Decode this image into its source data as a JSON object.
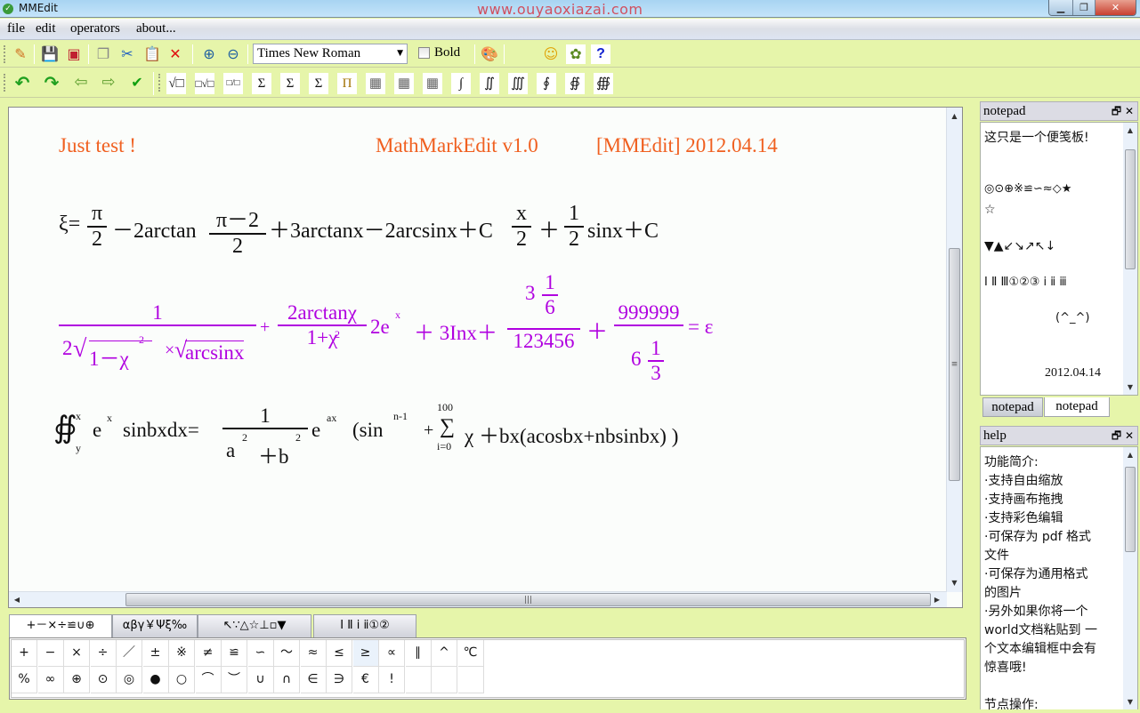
{
  "window": {
    "title": "MMEdit",
    "watermark": "www.ouyaoxiazai.com",
    "minimize": "▁",
    "restore": "❐",
    "close": "✕"
  },
  "menu": [
    "file",
    "edit",
    "operators",
    "about..."
  ],
  "toolbar1": {
    "icons": [
      "edit-pencil-icon",
      "save-icon",
      "save-pdf-icon",
      "copy-icon",
      "cut-icon",
      "paste-icon",
      "delete-icon",
      "zoom-in-icon",
      "zoom-out-icon"
    ],
    "font_family": "Times New Roman",
    "bold_label": "Bold",
    "bold_checked": false,
    "extra_icons": [
      "palette-icon",
      "smiley-icon",
      "plant-icon",
      "help-icon"
    ]
  },
  "toolbar2": {
    "nav_icons": [
      "undo-icon",
      "redo-icon",
      "back-icon",
      "forward-icon",
      "confirm-icon"
    ],
    "math_buttons": [
      "√□",
      "□√□",
      "□/□",
      "Σ",
      "Σ",
      "Σ",
      "Π",
      "▦",
      "▦",
      "▦",
      "∫",
      "∬",
      "∭",
      "∮",
      "∯",
      "∰"
    ]
  },
  "canvas": {
    "header_left": "Just  test !",
    "header_center": "MathMarkEdit v1.0",
    "header_right": "[MMEdit]  2012.04.14",
    "colors": {
      "header": "#f06020",
      "eq1": "#111111",
      "eq2": "#b000e0",
      "eq3": "#111111"
    },
    "eq1": {
      "lhs": "ξ=",
      "f1_num": "π",
      "f1_den": "2",
      "t1": "－2arctan",
      "f2_num": "π－2",
      "f2_den": "2",
      "t2": "＋3arctanx－2arcsinx＋C",
      "f3_num": "x",
      "f3_den": "2",
      "t3": "＋",
      "f4_num": "1",
      "f4_den": "2",
      "t4": "sinx＋C"
    },
    "eq2": {
      "f1_num": "1",
      "f1_den_a": "2",
      "f1_den_root1": "1－χ",
      "f1_den_exp": "2",
      "f1_den_times": "×",
      "f1_den_root2": "arcsinx",
      "plus1": "+",
      "f2_num": "2arctanχ",
      "f2_den": "1+χ",
      "f2_den_exp": "2",
      "t1": "2e",
      "t1_exp": "x",
      "t2": "＋ 3Inx＋",
      "f3_num_whole": "3",
      "f3_num_num": "1",
      "f3_num_den": "6",
      "f3_den": "123456",
      "plus2": "＋",
      "f4_num": "999999",
      "f4_den_whole": "6",
      "f4_den_num": "1",
      "f4_den_den": "3",
      "rhs": "= ε"
    },
    "eq3": {
      "integral": "∯",
      "int_upper": "x",
      "int_lower": "y",
      "t1": "e",
      "t1_exp": "x",
      "t2": "sinbxdx=",
      "f_num": "1",
      "f_den_a": "a",
      "f_den_a_exp": "2",
      "f_den_b": "＋b",
      "f_den_b_exp": "2",
      "t3": "e",
      "t3_exp": "ax",
      "t4": "(sin",
      "t4_exp": "n-1",
      "t5": "+",
      "sum": "∑",
      "sum_upper": "100",
      "sum_lower": "i=0",
      "t6": "χ ＋bx(acosbx+nbsinbx) )"
    }
  },
  "notepad": {
    "title": "notepad",
    "lines": [
      "这只是一个便笺板!",
      "",
      "◎⊙⊕※≌∽≈◇★",
      "☆",
      "",
      "▼▲↙↘↗↖↓",
      "",
      "Ⅰ Ⅱ Ⅲ①②③ ⅰ ⅱ ⅲ",
      "",
      "(^_^)",
      "",
      "2012.04.14"
    ],
    "tabs": [
      "notepad",
      "notepad"
    ],
    "active_tab": 1
  },
  "help": {
    "title": "help",
    "lines": [
      "功能简介:",
      "  ·支持自由缩放",
      "  ·支持画布拖拽",
      "  ·支持彩色编辑",
      "  ·可保存为 pdf 格式",
      "文件",
      "  ·可保存为通用格式",
      "的图片",
      "  ·另外如果你将一个",
      "world文档粘贴到  一",
      "个文本编辑框中会有",
      "惊喜哦!",
      "",
      "节点操作:"
    ]
  },
  "symbol_palette": {
    "tabs": [
      "+－×÷≌∪⊕",
      "αβγ￥Ψξ‰",
      "↖∵△☆⊥▫▼",
      "Ⅰ Ⅱ ⅰ ⅱ①②"
    ],
    "active_tab": 0,
    "row1": [
      "+",
      "−",
      "×",
      "÷",
      "／",
      "±",
      "※",
      "≠",
      "≌",
      "∽",
      "～",
      "≈",
      "≤",
      "≥",
      "∝",
      "∥",
      "^",
      "℃"
    ],
    "row2": [
      "%",
      "∞",
      "⊕",
      "⊙",
      "◎",
      "●",
      "○",
      "⌒",
      "︶",
      "∪",
      "∩",
      "∈",
      "∋",
      "€",
      "!",
      "",
      "",
      ""
    ],
    "highlighted": "≥"
  }
}
